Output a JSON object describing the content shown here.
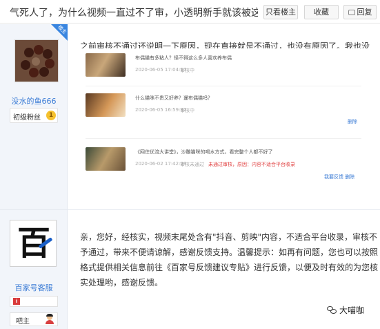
{
  "header": {
    "title": "气死人了，为什么视频一直过不了审，小透明新手就该被这样对...",
    "buttons": {
      "only_op": "只看楼主",
      "collect": "收藏",
      "reply": "回复"
    }
  },
  "post1": {
    "op_badge": "楼主",
    "username": "没水的鱼666",
    "level_label": "初级粉丝",
    "level_num": "1",
    "content": "之前审核不通过还说明一下原因，现在直接就是不通过，也没有原因了。我也没有任何的营销内容，也是冲着要好好做内容来的，现在第一步就把人打死，太难受了。",
    "screenshot": {
      "cards": [
        {
          "title": "布偶猫有多粘人？怪不得这么多人喜欢养布偶",
          "date": "2020-06-05 17:04:17",
          "status": "审核中",
          "reason": "",
          "action": ""
        },
        {
          "title": "什么猫咪不贵又好养？暹布偶猫吗？",
          "date": "2020-06-05 16:59:32",
          "status": "审核中",
          "reason": "",
          "action": "删除"
        },
        {
          "title": "《网住优流大讲堂》，沙雕猫咪的喝水方式，看完整个人都不好了",
          "date": "2020-06-02 17:42:29",
          "status": "审核未通过",
          "reason": "未通过审核，原因：内容不适合平台收录",
          "action": "我要反馈  删除"
        }
      ]
    }
  },
  "post2": {
    "avatar_char": "百",
    "username": "百家号客服",
    "level_icon": "i",
    "role": "吧主",
    "content": "亲，您好，经核实，视频末尾处含有\"抖音、剪映\"内容，不适合平台收录，审核不予通过，带来不便请谅解，感谢反馈支持。温馨提示：如再有问题，您也可以按照格式提供相关信息前往《百家号反馈建议专贴》进行反馈，以便及时有效的为您核实处理哟，感谢反馈。"
  },
  "watermark": "大喵咖"
}
